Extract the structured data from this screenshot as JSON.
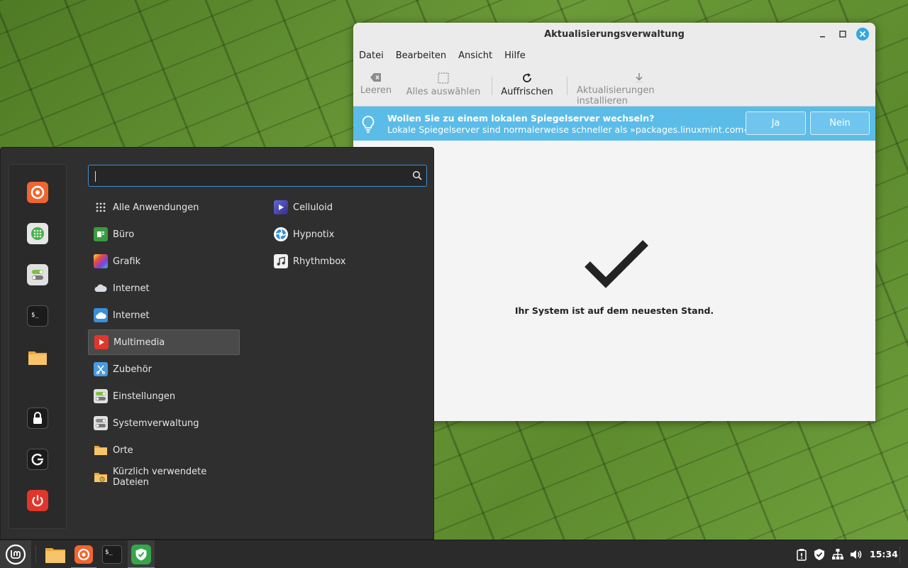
{
  "window": {
    "title": "Aktualisierungsverwaltung",
    "menus": [
      "Datei",
      "Bearbeiten",
      "Ansicht",
      "Hilfe"
    ],
    "toolbar": {
      "clear": "Leeren",
      "select_all": "Alles auswählen",
      "refresh": "Auffrischen",
      "install": "Aktualisierungen installieren"
    },
    "infobar": {
      "title": "Wollen Sie zu einem lokalen Spiegelserver wechseln?",
      "text": "Lokale Spiegelserver sind normalerweise schneller als »packages.linuxmint.com«.",
      "yes": "Ja",
      "no": "Nein"
    },
    "status": "Ihr System ist auf dem neuesten Stand."
  },
  "menu": {
    "search_value": "",
    "favorites": [
      "firefox-icon",
      "grid-app-icon",
      "settings-toggle-icon",
      "terminal-icon",
      "folder-icon"
    ],
    "session": [
      "lock-icon",
      "logout-icon",
      "power-icon"
    ],
    "categories": [
      {
        "label": "Alle Anwendungen",
        "icon": "grid-dots-icon"
      },
      {
        "label": "Büro",
        "icon": "office-icon"
      },
      {
        "label": "Grafik",
        "icon": "graphics-icon"
      },
      {
        "label": "Internet",
        "icon": "cloud-dark-icon"
      },
      {
        "label": "Internet",
        "icon": "cloud-blue-icon"
      },
      {
        "label": "Multimedia",
        "icon": "multimedia-icon",
        "selected": true
      },
      {
        "label": "Zubehör",
        "icon": "accessories-icon"
      },
      {
        "label": "Einstellungen",
        "icon": "settings-icon"
      },
      {
        "label": "Systemverwaltung",
        "icon": "system-icon"
      },
      {
        "label": "Orte",
        "icon": "folder-icon"
      },
      {
        "label": "Kürzlich verwendete Dateien",
        "icon": "recent-files-icon"
      }
    ],
    "apps": [
      {
        "label": "Celluloid",
        "icon": "celluloid-icon"
      },
      {
        "label": "Hypnotix",
        "icon": "hypnotix-icon"
      },
      {
        "label": "Rhythmbox",
        "icon": "rhythmbox-icon"
      }
    ]
  },
  "taskbar": {
    "clock": "15:34"
  },
  "colors": {
    "accent": "#35a7e0",
    "infobar": "#5bbce8",
    "menu_bg": "#2f2f2f",
    "wallpaper": "#5f8a2e"
  }
}
